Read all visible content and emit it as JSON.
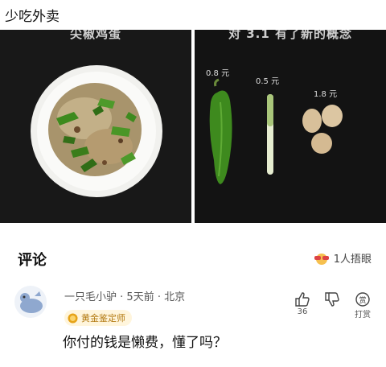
{
  "post": {
    "text": "少吃外卖"
  },
  "images": {
    "left_caption": "尖椒鸡蛋",
    "right_caption": "对 3.1 有了新的概念",
    "price_pepper": "0.8 元",
    "price_scallion": "0.5 元",
    "price_eggs": "1.8 元"
  },
  "comments": {
    "header": "评论",
    "reaction_count": "1人捂眼",
    "item": {
      "username": "一只毛小驴",
      "time": "5天前",
      "location": "北京",
      "badge": "黄金鉴定师",
      "text": "你付的钱是懒费，懂了吗？",
      "like_count": "36",
      "reward_label": "打赏"
    }
  },
  "colors": {
    "pepper": "#3e8a1e",
    "egg": "#d8c09a",
    "badge_bg": "#fff5dc",
    "badge_text": "#b37a12"
  }
}
